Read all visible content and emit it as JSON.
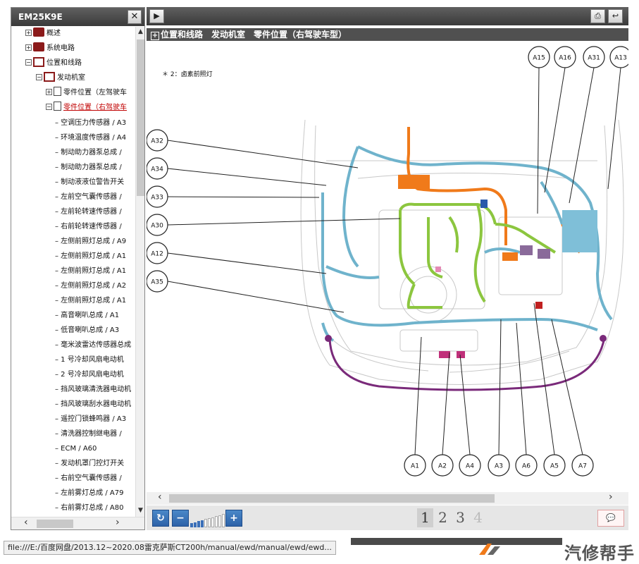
{
  "left_panel": {
    "title": "EM25K9E",
    "close_label": "✕",
    "tree": [
      {
        "label": "概述",
        "expander": "+",
        "icon": "book"
      },
      {
        "label": "系统电路",
        "expander": "+",
        "icon": "book"
      },
      {
        "label": "位置和线路",
        "expander": "−",
        "icon": "open-book"
      },
      {
        "label": "发动机室",
        "expander": "−",
        "icon": "open-book"
      },
      {
        "label": "零件位置（左驾驶车",
        "expander": "+",
        "icon": "doc"
      },
      {
        "label": "零件位置（右驾驶车",
        "expander": "−",
        "icon": "doc",
        "selected": true
      }
    ],
    "leaves": [
      "空调压力传感器 / A3",
      "环境温度传感器 / A4",
      "制动助力器泵总成 /",
      "制动助力器泵总成 /",
      "制动液液位警告开关",
      "左前空气囊传感器 /",
      "左前轮转速传感器 /",
      "右前轮转速传感器 /",
      "左侧前照灯总成 / A9",
      "左侧前照灯总成 / A1",
      "左侧前照灯总成 / A1",
      "左侧前照灯总成 / A2",
      "左侧前照灯总成 / A1",
      "高音喇叭总成 / A1",
      "低音喇叭总成 / A3",
      "毫米波雷达传感器总成",
      "1 号冷却风扇电动机",
      "2 号冷却风扇电动机",
      "挡风玻璃清洗器电动机",
      "挡风玻璃刮水器电动机",
      "遥控门锁蜂鸣器 / A3",
      "清洗器控制继电器 /",
      "ECM / A60",
      "发动机罩门控灯开关",
      "右前空气囊传感器 /",
      "左前雾灯总成 / A79",
      "右前雾灯总成 / A80"
    ],
    "leaf_prefix": "–"
  },
  "toolbar": {
    "play_icon": "play-icon",
    "print_icon": "print-icon",
    "back_icon": "return-icon"
  },
  "content": {
    "title_box": "+",
    "title": "位置和线路　发动机室　零件位置（右驾驶车型）",
    "note": "＊ 2：卤素前照灯"
  },
  "callouts": {
    "top": [
      "A15",
      "A16",
      "A31",
      "A13"
    ],
    "left": [
      "A32",
      "A34",
      "A33",
      "A30",
      "A12",
      "A35"
    ],
    "bottom": [
      "A1",
      "A2",
      "A4",
      "A3",
      "A6",
      "A5",
      "A7"
    ]
  },
  "bottom_bar": {
    "pages": [
      "1",
      "2",
      "3",
      "4"
    ],
    "active_page": "1",
    "zoom_level": 4,
    "zoom_max": 10,
    "chat_label": "💬"
  },
  "status": {
    "url": "file:///E:/百度网盘/2013.12~2020.08雷克萨斯CT200h/manual/ewd/manual/ewd/ewd..."
  },
  "watermark": "汽修帮手",
  "colors": {
    "wire_blue": "#6fb3cc",
    "wire_green": "#8cc63f",
    "wire_orange": "#f07a1a",
    "wire_purple": "#7a2a7a",
    "header": "#4a4a4a"
  }
}
